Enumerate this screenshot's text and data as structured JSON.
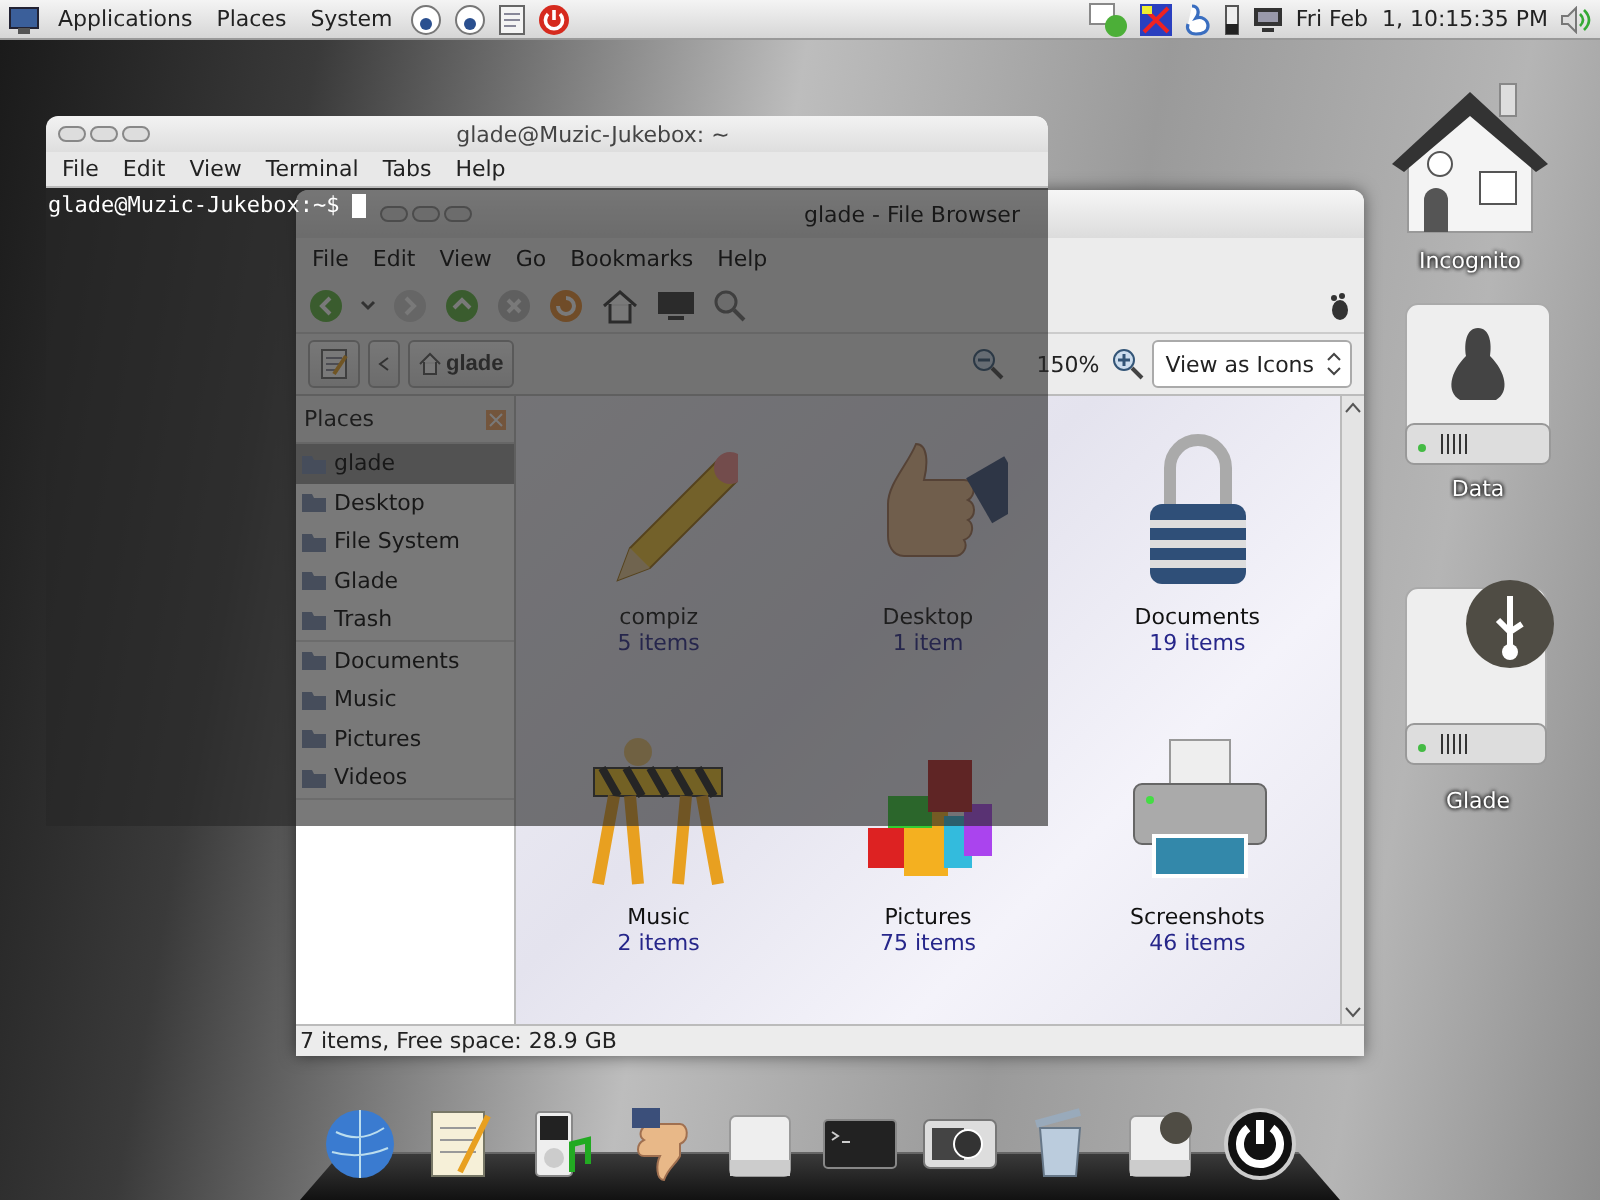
{
  "top_panel": {
    "menus": [
      "Applications",
      "Places",
      "System"
    ],
    "clock": "Fri Feb  1, 10:15:35 PM"
  },
  "desktop_icons": [
    {
      "label": "Incognito"
    },
    {
      "label": "Data"
    },
    {
      "label": "Glade"
    }
  ],
  "file_browser": {
    "title": "glade - File Browser",
    "menu": [
      "File",
      "Edit",
      "View",
      "Go",
      "Bookmarks",
      "Help"
    ],
    "location": "glade",
    "zoom": "150%",
    "view_mode": "View as Icons",
    "sidebar": {
      "header": "Places",
      "items": [
        {
          "label": "glade",
          "selected": true
        },
        {
          "label": "Desktop",
          "selected": false
        },
        {
          "label": "File System",
          "selected": false
        },
        {
          "label": "Glade",
          "selected": false
        },
        {
          "label": "Trash",
          "selected": false
        }
      ],
      "bookmarks": [
        {
          "label": "Documents",
          "selected": false
        },
        {
          "label": "Music",
          "selected": false
        },
        {
          "label": "Pictures",
          "selected": false
        },
        {
          "label": "Videos",
          "selected": false
        }
      ]
    },
    "items": [
      {
        "name": "compiz",
        "count": "5 items"
      },
      {
        "name": "Desktop",
        "count": "1 item"
      },
      {
        "name": "Documents",
        "count": "19 items"
      },
      {
        "name": "Music",
        "count": "2 items"
      },
      {
        "name": "Pictures",
        "count": "75 items"
      },
      {
        "name": "Screenshots",
        "count": "46 items"
      }
    ],
    "status": "7 items, Free space: 28.9 GB"
  },
  "terminal": {
    "title": "glade@Muzic-Jukebox: ~",
    "menu": [
      "File",
      "Edit",
      "View",
      "Terminal",
      "Tabs",
      "Help"
    ],
    "prompt": "glade@Muzic-Jukebox:~$"
  }
}
